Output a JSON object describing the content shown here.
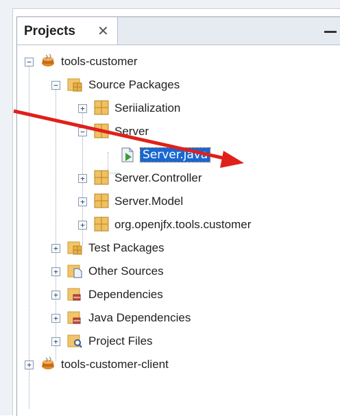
{
  "panel": {
    "tab_label": "Projects",
    "close_glyph": "✕"
  },
  "tree": {
    "nodes": [
      {
        "label": "tools-customer"
      },
      {
        "label": "Source Packages"
      },
      {
        "label": "Seriialization"
      },
      {
        "label": "Server"
      },
      {
        "label": "Server.java",
        "selected": true
      },
      {
        "label": "Server.Controller"
      },
      {
        "label": "Server.Model"
      },
      {
        "label": "org.openjfx.tools.customer"
      },
      {
        "label": "Test Packages"
      },
      {
        "label": "Other Sources"
      },
      {
        "label": "Dependencies"
      },
      {
        "label": "Java Dependencies"
      },
      {
        "label": "Project Files"
      },
      {
        "label": "tools-customer-client"
      }
    ]
  },
  "colors": {
    "selection": "#1967d2",
    "arrow": "#e0201b"
  }
}
